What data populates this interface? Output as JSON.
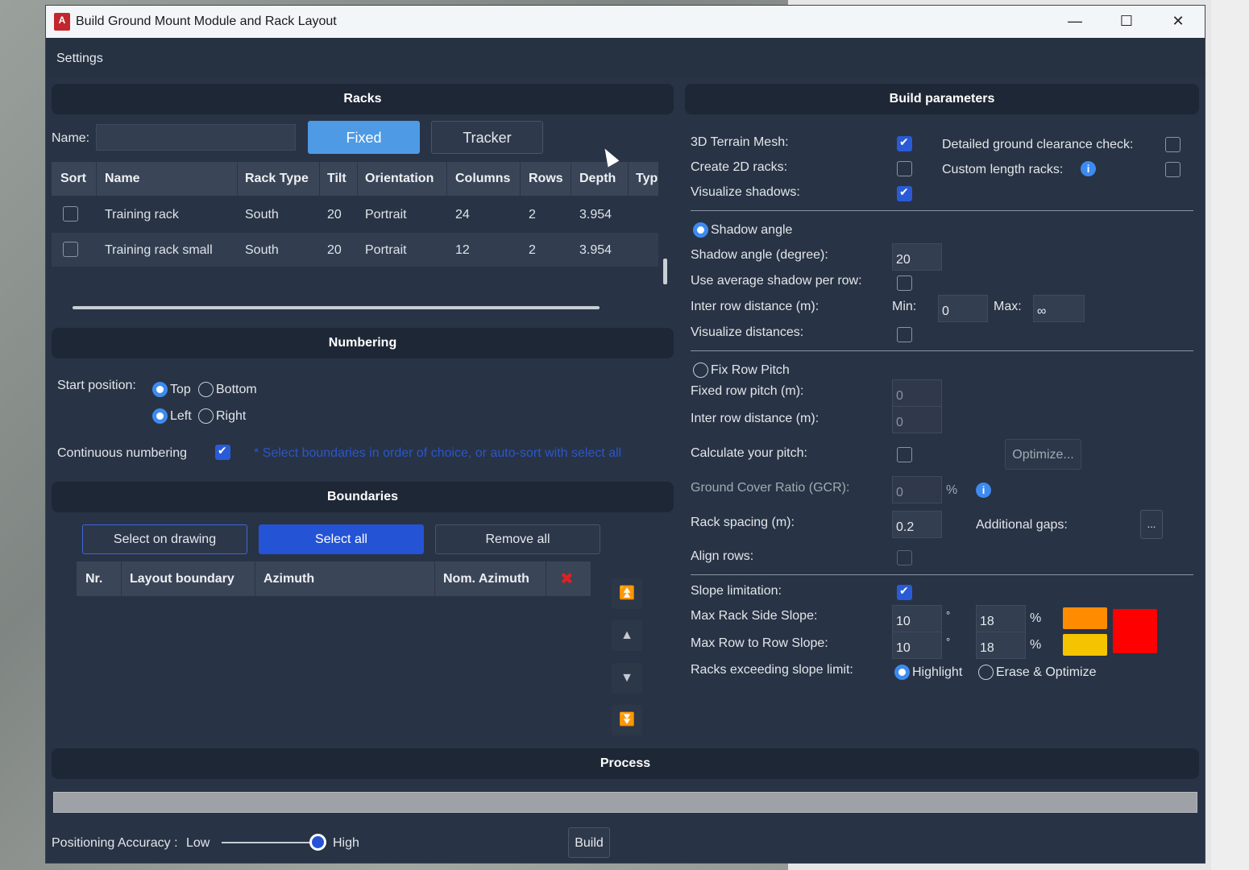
{
  "window": {
    "title": "Build Ground Mount Module and Rack Layout",
    "app_icon": "A"
  },
  "menu": {
    "settings": "Settings"
  },
  "racks": {
    "header": "Racks",
    "name_label": "Name:",
    "name_value": "",
    "fixed_label": "Fixed",
    "tracker_label": "Tracker",
    "columns": [
      "Sort",
      "Name",
      "Rack Type",
      "Tilt",
      "Orientation",
      "Columns",
      "Rows",
      "Depth",
      "Typ"
    ],
    "rows": [
      {
        "name": "Training rack",
        "rack_type": "South",
        "tilt": "20",
        "orientation": "Portrait",
        "columns": "24",
        "rows": "2",
        "depth": "3.954"
      },
      {
        "name": "Training rack small",
        "rack_type": "South",
        "tilt": "20",
        "orientation": "Portrait",
        "columns": "12",
        "rows": "2",
        "depth": "3.954"
      }
    ]
  },
  "numbering": {
    "header": "Numbering",
    "start_position_label": "Start position:",
    "top": "Top",
    "bottom": "Bottom",
    "left": "Left",
    "right": "Right",
    "continuous_label": "Continuous numbering",
    "hint": "* Select boundaries in order of choice, or auto-sort with select all"
  },
  "boundaries": {
    "header": "Boundaries",
    "select_on_drawing": "Select on drawing",
    "select_all": "Select all",
    "remove_all": "Remove all",
    "columns": [
      "Nr.",
      "Layout boundary",
      "Azimuth",
      "Nom. Azimuth"
    ]
  },
  "build": {
    "header": "Build parameters",
    "terrain_mesh": "3D Terrain Mesh:",
    "create_2d": "Create 2D racks:",
    "visualize_shadows": "Visualize shadows:",
    "detailed_check": "Detailed ground clearance check:",
    "custom_length": "Custom length racks:",
    "shadow_angle_radio": "Shadow angle",
    "shadow_angle_label": "Shadow angle (degree):",
    "shadow_angle_value": "20",
    "avg_shadow": "Use average shadow per row:",
    "inter_row_distance": "Inter row distance (m):",
    "min_label": "Min:",
    "min_value": "0",
    "max_label": "Max:",
    "max_value": "∞",
    "visualize_distances": "Visualize distances:",
    "fix_row_pitch": "Fix Row Pitch",
    "fixed_row_pitch": "Fixed row pitch (m):",
    "fixed_row_pitch_value": "0",
    "inter_row_distance2": "Inter row distance (m):",
    "inter_row_distance2_value": "0",
    "calc_pitch": "Calculate your pitch:",
    "optimize": "Optimize...",
    "gcr": "Ground Cover Ratio (GCR):",
    "gcr_value": "0",
    "percent": "%",
    "rack_spacing": "Rack spacing (m):",
    "rack_spacing_value": "0.2",
    "additional_gaps": "Additional gaps:",
    "gaps_button": "...",
    "align_rows": "Align rows:",
    "slope_limitation": "Slope limitation:",
    "max_rack_side": "Max Rack Side Slope:",
    "max_rack_side_deg": "10",
    "max_rack_side_pct": "18",
    "max_row_to_row": "Max Row to Row Slope:",
    "max_row_to_row_deg": "10",
    "max_row_to_row_pct": "18",
    "degree": "°",
    "exceeding": "Racks exceeding slope limit:",
    "highlight": "Highlight",
    "erase_optimize": "Erase & Optimize",
    "colors": {
      "orange": "#ff8c00",
      "yellow": "#f5c400",
      "red": "#ff0000"
    }
  },
  "process": {
    "header": "Process",
    "accuracy_label": "Positioning Accuracy :",
    "low": "Low",
    "high": "High",
    "build": "Build",
    "accuracy_value": 1.0
  }
}
